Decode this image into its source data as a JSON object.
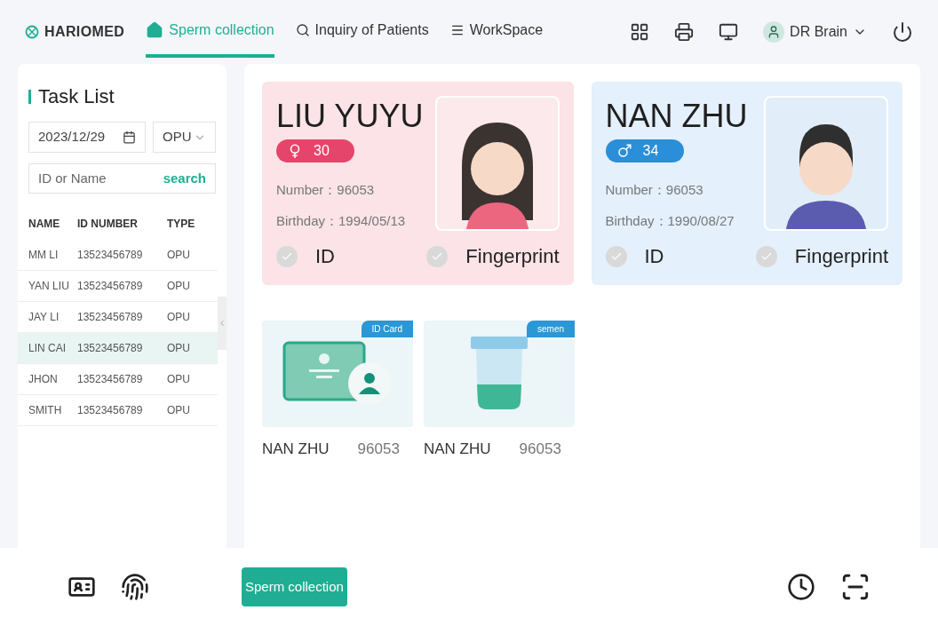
{
  "brand": "HARIOMED",
  "nav": [
    {
      "label": "Sperm collection",
      "kind": "home",
      "selected": true
    },
    {
      "label": "Inquiry of Patients",
      "kind": "search",
      "selected": false
    },
    {
      "label": "WorkSpace",
      "kind": "menu",
      "selected": false
    }
  ],
  "user": {
    "name": "DR Brain"
  },
  "task_list": {
    "title": "Task List",
    "date": "2023/12/29",
    "type_filter": "OPU",
    "search": {
      "placeholder": "ID or Name",
      "button": "search"
    },
    "columns": [
      "NAME",
      "ID NUMBER",
      "TYPE"
    ],
    "rows": [
      {
        "cells": [
          "MM LI",
          "13523456789",
          "OPU"
        ],
        "selected": false
      },
      {
        "cells": [
          "YAN LIU",
          "13523456789",
          "OPU"
        ],
        "selected": false
      },
      {
        "cells": [
          "JAY LI",
          "13523456789",
          "OPU"
        ],
        "selected": false
      },
      {
        "cells": [
          "LIN CAI",
          "13523456789",
          "OPU"
        ],
        "selected": true
      },
      {
        "cells": [
          "JHON",
          "13523456789",
          "OPU"
        ],
        "selected": false
      },
      {
        "cells": [
          "SMITH",
          "13523456789",
          "OPU"
        ],
        "selected": false
      }
    ]
  },
  "patients": [
    {
      "name": "LIU YUYU",
      "kind": "female",
      "age": "30",
      "number": "Number：96053",
      "birthday": "Birthday：1994/05/13",
      "checks": [
        {
          "label": "ID",
          "checked": false
        },
        {
          "label": "Fingerprint",
          "checked": false
        }
      ]
    },
    {
      "name": "NAN ZHU",
      "kind": "male",
      "age": "34",
      "number": "Number：96053",
      "birthday": "Birthday：1990/08/27",
      "checks": [
        {
          "label": "ID",
          "checked": false
        },
        {
          "label": "Fingerprint",
          "checked": false
        }
      ]
    }
  ],
  "samples": [
    {
      "kind": "idcard",
      "tag": "ID Card",
      "name": "NAN ZHU",
      "number": "96053"
    },
    {
      "kind": "semen",
      "tag": "semen",
      "name": "NAN ZHU",
      "number": "96053"
    }
  ],
  "bottom": {
    "action": "Sperm collection"
  }
}
